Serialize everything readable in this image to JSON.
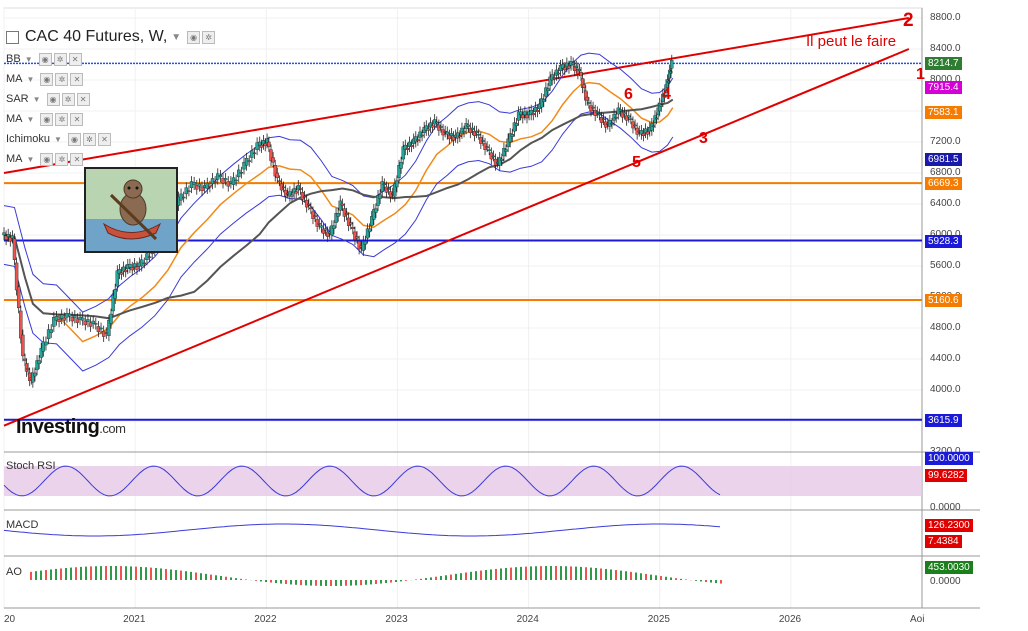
{
  "header": {
    "title": "CAC 40 Futures, W,",
    "indicators": [
      {
        "name": "BB"
      },
      {
        "name": "MA"
      },
      {
        "name": "SAR"
      },
      {
        "name": "MA"
      },
      {
        "name": "Ichimoku"
      },
      {
        "name": "MA"
      }
    ]
  },
  "annotations": {
    "note": "Il peut le faire",
    "labels": [
      "2",
      "1",
      "6",
      "4",
      "3",
      "5"
    ]
  },
  "logo": {
    "brand": "Investing",
    "suffix": ".com"
  },
  "price_badges": [
    {
      "value": "8214.7",
      "color": "#2e7d32"
    },
    {
      "value": "7915.4",
      "color": "#d500d5"
    },
    {
      "value": "7583.1",
      "color": "#f57c00"
    },
    {
      "value": "6981.5",
      "color": "#1a1aa8"
    },
    {
      "value": "6669.3",
      "color": "#f57c00"
    },
    {
      "value": "5928.3",
      "color": "#1a1ad8"
    },
    {
      "value": "5160.6",
      "color": "#f57c00"
    },
    {
      "value": "3615.9",
      "color": "#1a1ad8"
    }
  ],
  "panels": {
    "stoch_rsi": {
      "label": "Stoch RSI",
      "badges": [
        "100.0000",
        "99.6282"
      ],
      "ticks": [
        "0.0000"
      ]
    },
    "macd": {
      "label": "MACD",
      "badges": [
        "126.2300",
        "7.4384"
      ]
    },
    "ao": {
      "label": "AO",
      "badges": [
        "453.0030"
      ],
      "ticks": [
        "0.0000"
      ]
    }
  },
  "colors": {
    "up": "#26a69a",
    "down": "#ef5350",
    "channel": "#e00000"
  },
  "chart_data": {
    "type": "line",
    "title": "CAC 40 Futures, W,",
    "ylim": [
      3200,
      8800
    ],
    "y_ticks": [
      3200,
      3600,
      4000,
      4400,
      4800,
      5200,
      5600,
      6000,
      6400,
      6800,
      7200,
      7600,
      8000,
      8400,
      8800
    ],
    "x_ticks": [
      "20",
      "2021",
      "2022",
      "2023",
      "2024",
      "2025",
      "2026",
      "Aoi"
    ],
    "x_range": [
      2020.0,
      2027.0
    ],
    "series": [
      {
        "values": [
          [
            2020.0,
            6000
          ],
          [
            2020.08,
            5950
          ],
          [
            2020.16,
            4400
          ],
          [
            2020.22,
            4100
          ],
          [
            2020.3,
            4500
          ],
          [
            2020.4,
            4900
          ],
          [
            2020.5,
            4950
          ],
          [
            2020.6,
            4900
          ],
          [
            2020.7,
            4850
          ],
          [
            2020.8,
            4700
          ],
          [
            2020.88,
            5500
          ],
          [
            2020.96,
            5580
          ],
          [
            2021.05,
            5600
          ],
          [
            2021.15,
            5800
          ],
          [
            2021.25,
            6100
          ],
          [
            2021.35,
            6450
          ],
          [
            2021.45,
            6650
          ],
          [
            2021.55,
            6600
          ],
          [
            2021.65,
            6750
          ],
          [
            2021.75,
            6650
          ],
          [
            2021.85,
            6900
          ],
          [
            2021.95,
            7150
          ],
          [
            2022.02,
            7200
          ],
          [
            2022.1,
            6700
          ],
          [
            2022.18,
            6500
          ],
          [
            2022.26,
            6600
          ],
          [
            2022.34,
            6350
          ],
          [
            2022.42,
            6100
          ],
          [
            2022.5,
            6000
          ],
          [
            2022.58,
            6400
          ],
          [
            2022.66,
            6100
          ],
          [
            2022.74,
            5800
          ],
          [
            2022.82,
            6200
          ],
          [
            2022.9,
            6650
          ],
          [
            2022.98,
            6500
          ],
          [
            2023.06,
            7100
          ],
          [
            2023.14,
            7200
          ],
          [
            2023.22,
            7350
          ],
          [
            2023.3,
            7450
          ],
          [
            2023.38,
            7300
          ],
          [
            2023.46,
            7250
          ],
          [
            2023.54,
            7400
          ],
          [
            2023.62,
            7300
          ],
          [
            2023.7,
            7100
          ],
          [
            2023.78,
            6900
          ],
          [
            2023.86,
            7200
          ],
          [
            2023.94,
            7550
          ],
          [
            2024.02,
            7550
          ],
          [
            2024.1,
            7650
          ],
          [
            2024.18,
            8000
          ],
          [
            2024.26,
            8150
          ],
          [
            2024.34,
            8200
          ],
          [
            2024.4,
            8100
          ],
          [
            2024.46,
            7700
          ],
          [
            2024.54,
            7550
          ],
          [
            2024.62,
            7400
          ],
          [
            2024.7,
            7600
          ],
          [
            2024.78,
            7500
          ],
          [
            2024.86,
            7300
          ],
          [
            2024.94,
            7350
          ],
          [
            2025.0,
            7600
          ],
          [
            2025.06,
            7900
          ],
          [
            2025.1,
            8214.7
          ]
        ]
      }
    ],
    "horizontal_levels": [
      8214.7,
      6669.3,
      5928.3,
      5160.6,
      3615.9
    ],
    "channel_upper": [
      [
        2020.0,
        6800
      ],
      [
        2026.9,
        8800
      ]
    ],
    "channel_lower": [
      [
        2020.0,
        3540
      ],
      [
        2026.9,
        8400
      ]
    ],
    "grid": true
  }
}
